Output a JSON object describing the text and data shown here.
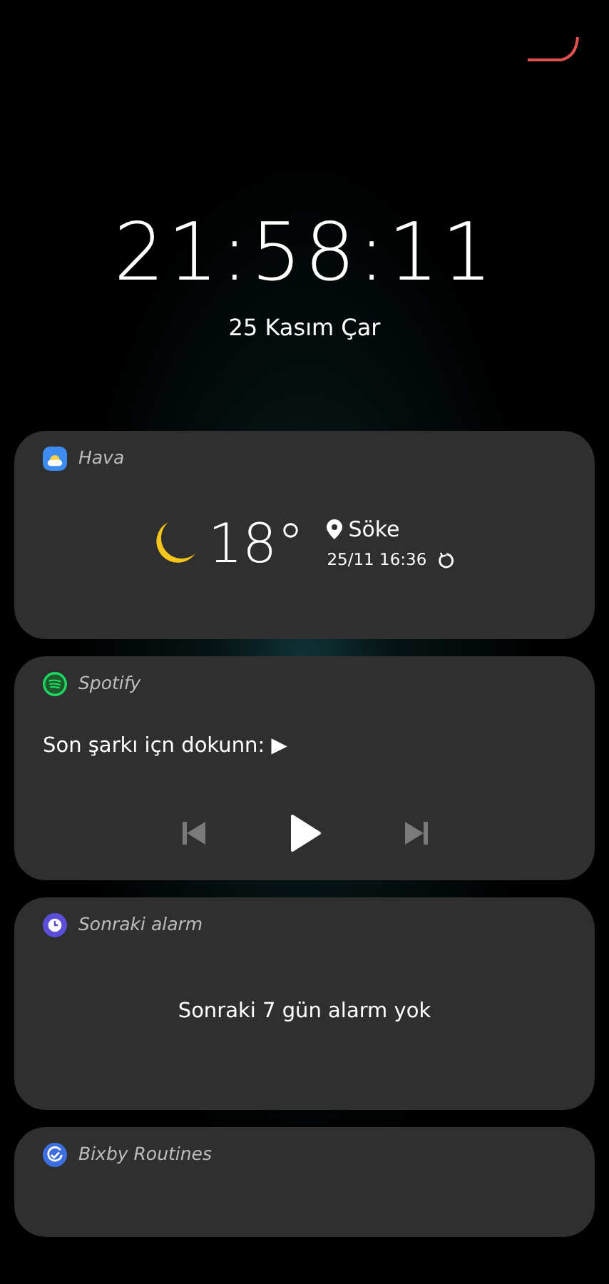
{
  "clock": {
    "time": "21:58:11",
    "date": "25 Kasım Çar"
  },
  "widgets": [
    {
      "kind": "weather",
      "app": "Hava",
      "temperature": "18°",
      "location": "Söke",
      "updated": "25/11 16:36"
    },
    {
      "kind": "media",
      "app": "Spotify",
      "message": "Son şarkı içn dokunn: ▶"
    },
    {
      "kind": "alarm",
      "app": "Sonraki alarm",
      "message": "Sonraki 7 gün alarm yok"
    },
    {
      "kind": "routine",
      "app": "Bixby Routines"
    }
  ]
}
